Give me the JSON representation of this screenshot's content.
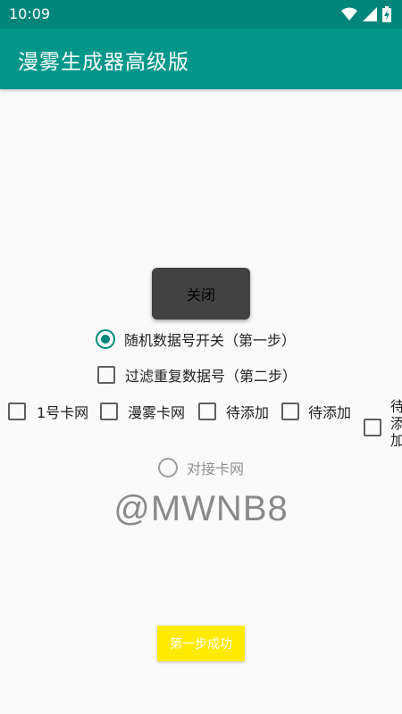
{
  "status_bar": {
    "time": "10:09",
    "icons": [
      "wifi-icon",
      "signal-icon",
      "battery-charging-icon"
    ]
  },
  "app_bar": {
    "title": "漫雾生成器高级版",
    "color": "#00978a"
  },
  "close_button": {
    "label": "关闭"
  },
  "random_switch": {
    "label": "随机数据号开关（第一步）",
    "checked": true
  },
  "filter_duplicates": {
    "label": "过滤重复数据号（第二步）",
    "checked": false
  },
  "card_options": [
    {
      "label": "1号卡网",
      "checked": false
    },
    {
      "label": "漫雾卡网",
      "checked": false
    },
    {
      "label": "待添加",
      "checked": false
    },
    {
      "label": "待添加",
      "checked": false
    },
    {
      "label": "待添加",
      "checked": false
    }
  ],
  "connect_card": {
    "label": "对接卡网",
    "checked": false
  },
  "watermark": "@MWNB8",
  "step_button": {
    "label": "第一步成功",
    "color": "#ffeb00"
  },
  "accent_color": "#00897b"
}
